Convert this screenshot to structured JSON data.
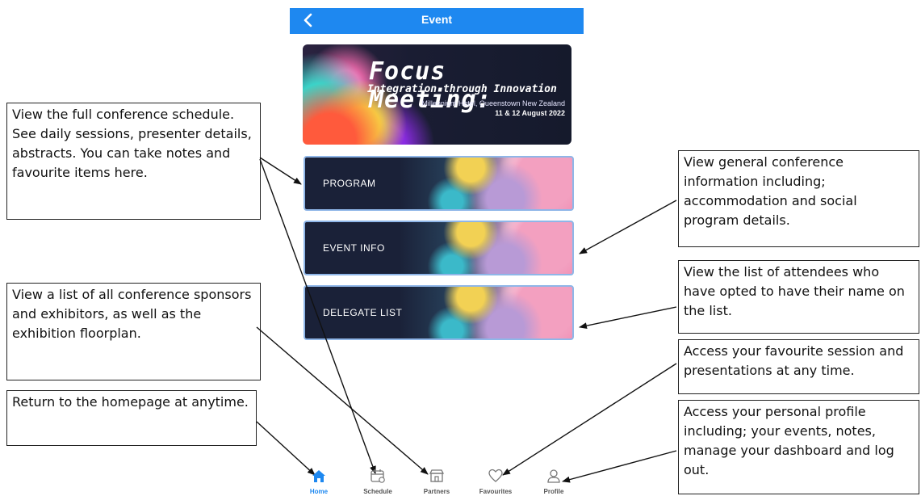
{
  "header": {
    "title": "Event",
    "back_icon": "chevron-left-icon"
  },
  "banner": {
    "title": "Focus Meeting:",
    "subtitle": "Integration through Innovation",
    "venue": "Millennium Hotel, Queenstown New Zealand",
    "date": "11 & 12 August  2022"
  },
  "menu": [
    {
      "label": "PROGRAM"
    },
    {
      "label": "EVENT INFO"
    },
    {
      "label": "DELEGATE LIST"
    }
  ],
  "nav": [
    {
      "label": "Home",
      "icon": "home-icon",
      "active": true
    },
    {
      "label": "Schedule",
      "icon": "calendar-icon",
      "active": false
    },
    {
      "label": "Partners",
      "icon": "storefront-icon",
      "active": false
    },
    {
      "label": "Favourites",
      "icon": "heart-icon",
      "active": false
    },
    {
      "label": "Profile",
      "icon": "user-icon",
      "active": false
    }
  ],
  "callouts": {
    "program": "View the full conference schedule. See daily sessions, presenter details, abstracts. You can take notes and favourite items here.",
    "sponsors": "View  a list of all conference sponsors and exhibitors, as well as the exhibition floorplan.",
    "home": "Return to the homepage at anytime.",
    "event_info": "View general conference information including; accommodation and social program details.",
    "delegates": "View the list of attendees who have opted to have their name on the list.",
    "favourites": "Access your favourite session and presentations at any time.",
    "profile": "Access your personal profile including; your events, notes, manage your dashboard and log out."
  },
  "colors": {
    "header": "#1e88f0",
    "nav_active": "#1e88f0",
    "nav_inactive": "#888888"
  }
}
